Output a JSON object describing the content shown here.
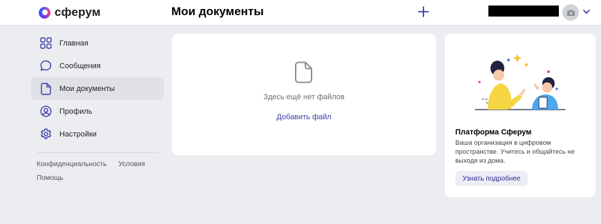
{
  "brand": {
    "name": "сферум"
  },
  "header": {
    "title": "Мои документы",
    "add_icon": "plus-icon",
    "avatar_icon": "camera-icon",
    "menu_icon": "chevron-down-icon"
  },
  "sidebar": {
    "items": [
      {
        "label": "Главная",
        "icon": "grid-icon"
      },
      {
        "label": "Сообщения",
        "icon": "chat-bubble-icon"
      },
      {
        "label": "Мои документы",
        "icon": "document-icon",
        "active": true
      },
      {
        "label": "Профиль",
        "icon": "user-circle-icon"
      },
      {
        "label": "Настройки",
        "icon": "gear-icon"
      }
    ],
    "footer": {
      "privacy": "Конфиденциальность",
      "terms": "Условия",
      "help": "Помощь"
    }
  },
  "documents": {
    "empty_text": "Здесь ещё нет файлов",
    "add_label": "Добавить файл"
  },
  "promo": {
    "title": "Платформа Сферум",
    "description": "Ваша организация в цифровом пространстве. Учитесь и общайтесь не выходя из дома.",
    "button_label": "Узнать подробнее"
  },
  "colors": {
    "accent": "#3a3aa8",
    "background": "#ebedf0",
    "card": "#ffffff",
    "active_nav": "#dfe1e7"
  }
}
